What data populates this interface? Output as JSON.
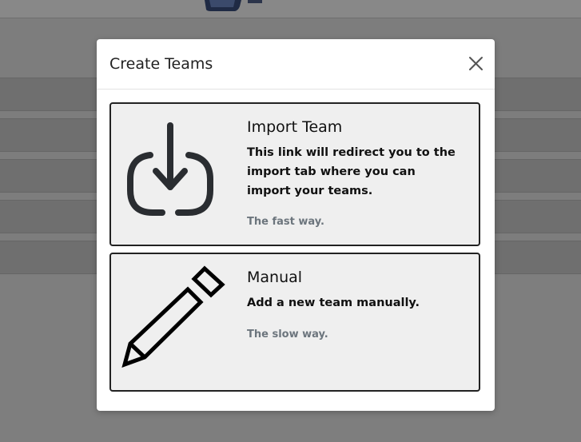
{
  "modal": {
    "title": "Create Teams",
    "close_icon": "close-icon",
    "options": [
      {
        "icon": "download-icon",
        "title": "Import Team",
        "description": "This link will redirect you to the import tab where you can import your teams.",
        "note": "The fast way."
      },
      {
        "icon": "pencil-icon",
        "title": "Manual",
        "description": "Add a new team manually.",
        "note": "The slow way."
      }
    ]
  },
  "colors": {
    "overlay": "#7d7d7d",
    "card_background": "#efefef",
    "card_border": "#222222",
    "muted_text": "#6c757d"
  }
}
